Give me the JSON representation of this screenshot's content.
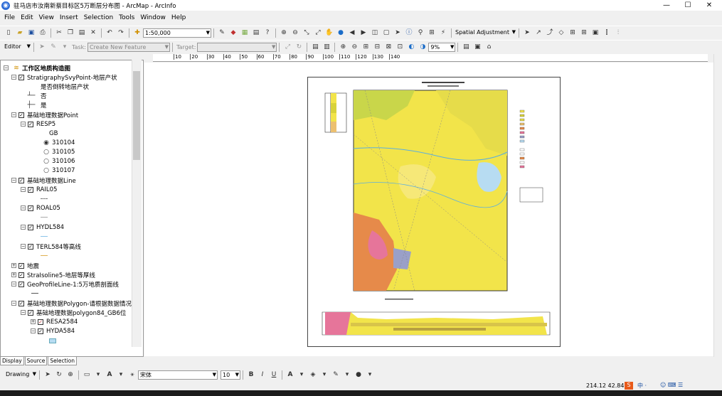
{
  "window": {
    "title": "驻马店市汝南新蔡目标区5万断层分布图 - ArcMap - ArcInfo",
    "minimize": "—",
    "maximize": "☐",
    "close": "✕"
  },
  "menu": [
    "File",
    "Edit",
    "View",
    "Insert",
    "Selection",
    "Tools",
    "Window",
    "Help"
  ],
  "standard_toolbar": {
    "scale": "1:50,000",
    "spatial_adjustment": "Spatial Adjustment"
  },
  "editor_toolbar": {
    "editor": "Editor",
    "task_label": "Task:",
    "task_value": "Create New Feature",
    "target_label": "Target:",
    "zoom_value": "9%"
  },
  "toc": {
    "root": "工作区地质构造图",
    "items": [
      {
        "label": "StratigraphySvyPoint-地层产状"
      },
      {
        "label": "是否倒转地层产状"
      },
      {
        "label": "否"
      },
      {
        "label": "是"
      },
      {
        "label": "基础地理数据Point"
      },
      {
        "label": "RESP5"
      },
      {
        "label": "GB"
      },
      {
        "label": "310104"
      },
      {
        "label": "310105"
      },
      {
        "label": "310106"
      },
      {
        "label": "310107"
      },
      {
        "label": "基础地理数据Line"
      },
      {
        "label": "RAIL05"
      },
      {
        "label": "ROAL05"
      },
      {
        "label": "HYDL584"
      },
      {
        "label": "TERL584等高线"
      },
      {
        "label": "地震"
      },
      {
        "label": "StraIsoline5-地层等厚线"
      },
      {
        "label": "GeoProfileLine-1:5万地质剖面线"
      },
      {
        "label": "基础地理数据Polygon-请根据数据情况"
      },
      {
        "label": "基础地理数据polygon84_GB6位"
      },
      {
        "label": "RESA2584"
      },
      {
        "label": "HYDA584"
      }
    ]
  },
  "tabs": [
    "Display",
    "Source",
    "Selection"
  ],
  "ruler_h": [
    "10",
    "20",
    "30",
    "40",
    "50",
    "60",
    "70",
    "80",
    "90",
    "100",
    "110",
    "120",
    "130",
    "140"
  ],
  "ruler_v": [
    "150",
    "140",
    "130",
    "120",
    "110",
    "100",
    "90",
    "80",
    "70",
    "60",
    "50",
    "40",
    "30"
  ],
  "drawing_toolbar": {
    "drawing": "Drawing",
    "font": "宋体",
    "size": "10",
    "bold": "B",
    "italic": "I",
    "underline": "U"
  },
  "status": {
    "coords": "214.12  42.84"
  },
  "taskbar": {
    "ime": "中 ·",
    "icons": "☺ ⌨ ☰"
  },
  "colors": {
    "map_yellow": "#f2e44a",
    "map_orange": "#e68a4a",
    "map_pink": "#e6759a",
    "map_lake": "#b7dcf2",
    "accent": "#2c6bd6"
  }
}
